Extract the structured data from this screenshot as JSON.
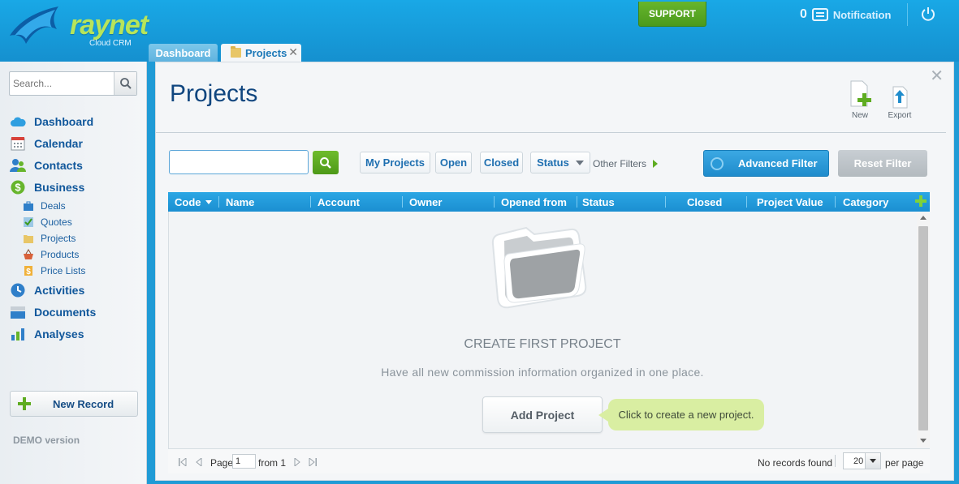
{
  "header": {
    "logo_text": "raynet",
    "logo_sub": "Cloud CRM",
    "support_label": "SUPPORT",
    "notification_count": "0",
    "notification_label": "Notification"
  },
  "tabs": [
    {
      "label": "Dashboard"
    },
    {
      "label": "Projects",
      "close": "✕"
    }
  ],
  "sidebar": {
    "search_placeholder": "Search...",
    "nav": [
      {
        "label": "Dashboard",
        "icon": "cloud-icon"
      },
      {
        "label": "Calendar",
        "icon": "calendar-icon"
      },
      {
        "label": "Contacts",
        "icon": "contacts-icon"
      },
      {
        "label": "Business",
        "icon": "dollar-icon"
      }
    ],
    "business_sub": [
      {
        "label": "Deals",
        "icon": "briefcase-icon"
      },
      {
        "label": "Quotes",
        "icon": "quotes-icon"
      },
      {
        "label": "Projects",
        "icon": "folder-icon"
      },
      {
        "label": "Products",
        "icon": "basket-icon"
      },
      {
        "label": "Price Lists",
        "icon": "pricelist-icon"
      }
    ],
    "nav_bottom": [
      {
        "label": "Activities",
        "icon": "activities-icon"
      },
      {
        "label": "Documents",
        "icon": "documents-icon"
      },
      {
        "label": "Analyses",
        "icon": "analyses-icon"
      }
    ],
    "new_record_label": "New Record",
    "demo_label": "DEMO version"
  },
  "main": {
    "title": "Projects",
    "toolbar": {
      "new_label": "New",
      "export_label": "Export"
    },
    "filters": {
      "search_value": "",
      "my_projects": "My Projects",
      "open": "Open",
      "closed": "Closed",
      "status": "Status",
      "other_filters": "Other Filters",
      "advanced_filter": "Advanced Filter",
      "reset_filter": "Reset Filter"
    },
    "grid": {
      "columns": [
        "Code",
        "Name",
        "Account",
        "Owner",
        "Opened from",
        "Status",
        "Closed",
        "Project Value",
        "Category"
      ]
    },
    "empty_state": {
      "title": "CREATE FIRST PROJECT",
      "subtitle": "Have all new commission information organized in one place.",
      "button": "Add Project",
      "tooltip": "Click to create a new project."
    },
    "pager": {
      "page_label": "Page",
      "page_value": "1",
      "from_label": "from 1",
      "no_records": "No records found",
      "per_page_value": "20",
      "per_page_label": "per page"
    }
  },
  "colors": {
    "brand_blue": "#1b8fd1",
    "brand_green": "#5eac21",
    "nav_text": "#10579b"
  }
}
